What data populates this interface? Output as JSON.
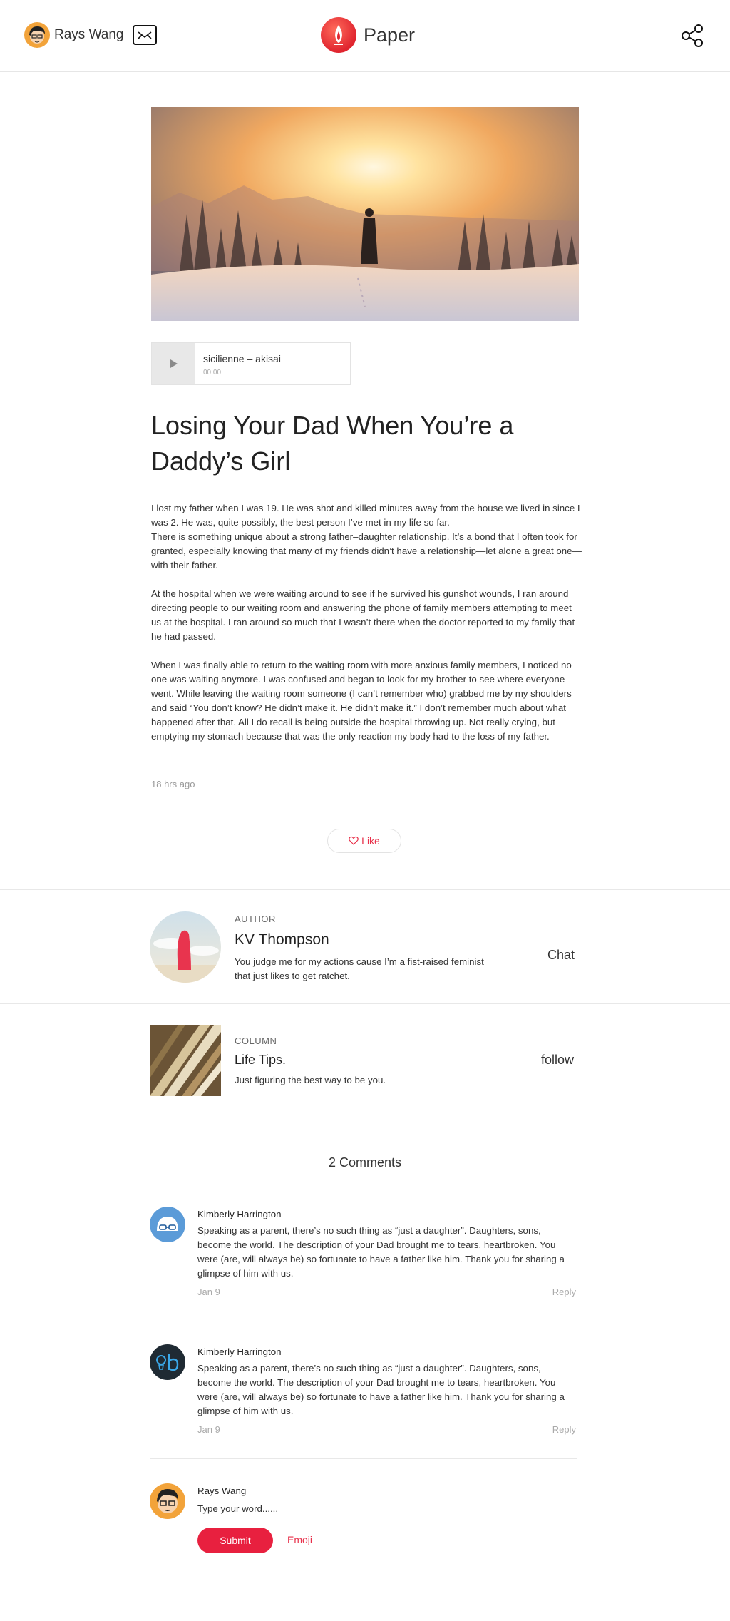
{
  "header": {
    "user_name": "Rays Wang",
    "brand": "Paper",
    "icons": [
      "avatar",
      "mail-icon",
      "paper-logo",
      "share-icon"
    ]
  },
  "audio": {
    "track_title": "sicilienne – akisai",
    "time": "00:00"
  },
  "article": {
    "title": "Losing Your Dad When You’re a Daddy’s Girl",
    "paragraphs": [
      "I lost my father when I was 19. He was shot and killed minutes away from the house we lived in since I was 2. He was, quite possibly, the best person I’ve met in my life so far.\nThere is something unique about a strong father–daughter relationship. It’s a bond that I often took for granted, especially knowing that many of my friends didn’t have a relationship—let alone a great one—with their father.",
      "At the hospital when we were waiting around to see if he survived his gunshot wounds, I ran around directing people to our waiting room and answering the phone of family members attempting to meet us at the hospital. I ran around so much that I wasn’t there when the doctor reported to my family that he had passed.",
      "When I was finally able to return to the waiting room with more anxious family members, I noticed no one was waiting anymore. I was confused and began to look for my brother to see where everyone went. While leaving the waiting room someone (I can’t remember who) grabbed me by my shoulders and said “You don’t know? He didn’t make it. He didn’t make it.” I don’t remember much about what happened after that. All I do recall is being outside the hospital throwing up. Not really crying, but emptying my stomach because that was the only reaction my body had to the loss of my father."
    ],
    "timestamp": "18 hrs ago",
    "like_label": "Like"
  },
  "author": {
    "label": "AUTHOR",
    "name": "KV Thompson",
    "bio": "You judge me for my actions cause I’m a fist-raised feminist that just likes to get ratchet.",
    "action": "Chat"
  },
  "column": {
    "label": "COLUMN",
    "name": "Life Tips.",
    "description": "Just figuring the best way to be you.",
    "action": "follow"
  },
  "comments": {
    "title": "2 Comments",
    "items": [
      {
        "name": "Kimberly Harrington",
        "text": "Speaking as a parent, there’s no such thing as “just a daughter”. Daughters, sons, become the world. The description of your Dad brought me to tears, heartbroken. You were (are, will always be) so fortunate to have a father like him. Thank you for sharing a glimpse of him with us.",
        "date": "Jan 9",
        "reply": "Reply"
      },
      {
        "name": "Kimberly Harrington",
        "text": "Speaking as a parent, there’s no such thing as “just a daughter”. Daughters, sons, become the world. The description of your Dad brought me to tears, heartbroken. You were (are, will always be) so fortunate to have a father like him. Thank you for sharing a glimpse of him with us.",
        "date": "Jan 9",
        "reply": "Reply"
      }
    ]
  },
  "compose": {
    "name": "Rays Wang",
    "placeholder": "Type your word......",
    "submit": "Submit",
    "emoji": "Emoji"
  },
  "colors": {
    "accent": "#e8203f",
    "divider": "#e8e8e8",
    "muted_text": "#999999"
  }
}
